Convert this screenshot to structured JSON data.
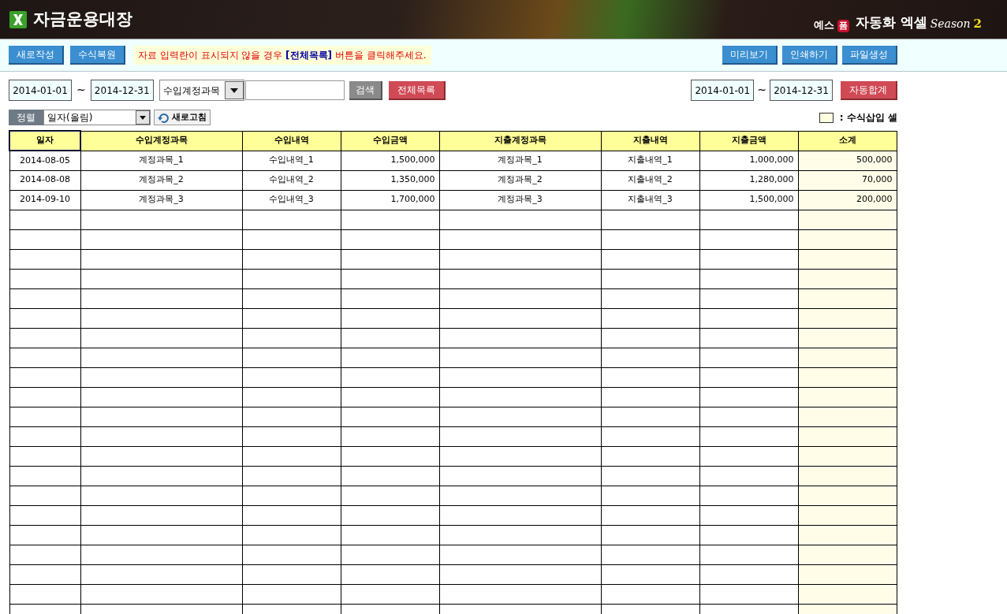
{
  "header": {
    "title": "자금운용대장",
    "brand": {
      "prefix": "예스",
      "badge": "폼",
      "name": "자동화 엑셀",
      "season": "Season",
      "season_number": "2"
    }
  },
  "toolbar": {
    "left_buttons": [
      "새로작성",
      "수식복원"
    ],
    "notice": "자료 입력란이 표시되지  않을 경우 **[전체목록]** 버튼을 클릭해주세요.",
    "right_buttons": [
      "미리보기",
      "인쇄하기",
      "파일생성"
    ]
  },
  "filter": {
    "from": "2014-01-01",
    "tilde": "~",
    "to": "2014-12-31",
    "field": "수입계정과목",
    "search_button": "검색",
    "all_button": "전체목록"
  },
  "total": {
    "from": "2014-01-01",
    "tilde": "~",
    "to": "2014-12-31",
    "button": "자동합계"
  },
  "sort": {
    "label": "정렬",
    "value": "일자(올림)",
    "refresh_button": "새로고침"
  },
  "legend": {
    "text": ": 수식삽입 셀"
  },
  "table": {
    "columns": [
      {
        "label": "일자",
        "kind": "text",
        "selected": true,
        "formula": false
      },
      {
        "label": "수입계정과목",
        "kind": "text",
        "selected": false,
        "formula": false
      },
      {
        "label": "수입내역",
        "kind": "text",
        "selected": false,
        "formula": false
      },
      {
        "label": "수입금액",
        "kind": "amount",
        "selected": false,
        "formula": false
      },
      {
        "label": "지출계정과목",
        "kind": "text",
        "selected": false,
        "formula": false
      },
      {
        "label": "지출내역",
        "kind": "text",
        "selected": false,
        "formula": false
      },
      {
        "label": "지출금액",
        "kind": "amount",
        "selected": false,
        "formula": false
      },
      {
        "label": "소계",
        "kind": "amount",
        "selected": false,
        "formula": true
      }
    ],
    "rows": [
      [
        "2014-08-05",
        "계정과목_1",
        "수입내역_1",
        "1,500,000",
        "계정과목_1",
        "지출내역_1",
        "1,000,000",
        "500,000"
      ],
      [
        "2014-08-08",
        "계정과목_2",
        "수입내역_2",
        "1,350,000",
        "계정과목_2",
        "지출내역_2",
        "1,280,000",
        "70,000"
      ],
      [
        "2014-09-10",
        "계정과목_3",
        "수입내역_3",
        "1,700,000",
        "계정과목_3",
        "지출내역_3",
        "1,500,000",
        "200,000"
      ]
    ]
  }
}
